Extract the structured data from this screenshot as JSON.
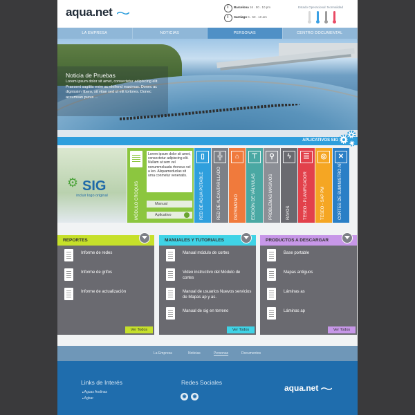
{
  "header": {
    "logo": "aqua.net",
    "clock1_city": "Barcelona",
    "clock1_time": "16 . 50 . 10 pm",
    "clock2_city": "Santiago",
    "clock2_time": "6 . 50 . 10 am",
    "status_title": "Estado Operacional: Normalidad",
    "status_colors": [
      "#d8d8d8",
      "#3aa0e4",
      "#9c9c9c",
      "#e94b65"
    ]
  },
  "nav": {
    "items": [
      "La Empresa",
      "Noticias",
      "Personas",
      "Centro Documental"
    ],
    "active": "Personas"
  },
  "hero": {
    "title": "Noticia de Pruebas",
    "text": "Lorem ipsum dolor sit amet, consectetur adipiscing elit. Praesent sagittis enim ac eleifend maximus. Donec ac dignissim libero, sit vitae sed ut elit tortores. Donec accumsan purus ..."
  },
  "sig": {
    "bar_label": "APLICATIVOS SIG",
    "logo": "SIG",
    "logo_sub": "incluir logo original",
    "croquis_text": "Lorem ipsum dolor sit amet, consectetur adipiscing elit. Nullam at sem vel nonummeluada rhoncus vel a leo. Aliquameduclas sit urna conmetur venenatis.",
    "manual_label": "Manual",
    "aplicativo_label": "Aplicativo",
    "croquis_label": "MÓDULO CROQUIS",
    "apps": [
      {
        "label": "RED DE AGUA POTABLE",
        "color": "#2f9fdd",
        "icon": "water-glass-icon",
        "glyph": "▯"
      },
      {
        "label": "RED DE ALCANTARILLADO",
        "color": "#7d8087",
        "icon": "pipe-icon",
        "glyph": "╬"
      },
      {
        "label": "PATRIMONIO",
        "color": "#f07a3c",
        "icon": "house-icon",
        "glyph": "⌂"
      },
      {
        "label": "EDICIÓN DE VÁLVULAS",
        "color": "#4aa8a3",
        "icon": "valve-icon",
        "glyph": "⊤"
      },
      {
        "label": "PROBLEMAS MASIVOS",
        "color": "#8c8f96",
        "icon": "magnifier-icon",
        "glyph": "⚲"
      },
      {
        "label": "RAYOS",
        "color": "#6a6a70",
        "icon": "lightning-icon",
        "glyph": "ϟ"
      },
      {
        "label": "TESEO - PLANIFICADOR",
        "color": "#e2414b",
        "icon": "checklist-icon",
        "glyph": "☰"
      },
      {
        "label": "TESEO - SAP PM",
        "color": "#f5a623",
        "icon": "target-icon",
        "glyph": "◎"
      },
      {
        "label": "CORTES DE SUMINISTRO AP",
        "color": "#2a7fc6",
        "icon": "cancel-icon",
        "glyph": "✕"
      }
    ]
  },
  "columns": [
    {
      "title": "REPORTES",
      "color": "#c6e02a",
      "items": [
        "Informe de redes",
        "Informe de grifos",
        "Informe de actualización"
      ],
      "ver": "Ver Todos"
    },
    {
      "title": "MANUALES Y TUTORIALES",
      "color": "#3fd3e6",
      "items": [
        "Manual módulo de cortes",
        "Video instructivo del Módulo de cortes",
        "Manual de usuarios Nuevos servicios de Mapas ap y as.",
        "Manual de sig en terreno"
      ],
      "ver": "Ver Todos"
    },
    {
      "title": "PRODUCTOS A DESCARGAR",
      "color": "#c797e8",
      "items": [
        "Base portable",
        "Mapas antiguos",
        "Láminas as",
        "Láminas ap"
      ],
      "ver": "Ver Todos"
    }
  ],
  "footer_nav": [
    "La Empresa",
    "Noticias",
    "Personas",
    "Documentos"
  ],
  "footer": {
    "links_title": "Links de Interés",
    "links": [
      "Aguas Andinas",
      "Agbar"
    ],
    "social_title": "Redes Sociales",
    "logo": "aqua.net"
  }
}
